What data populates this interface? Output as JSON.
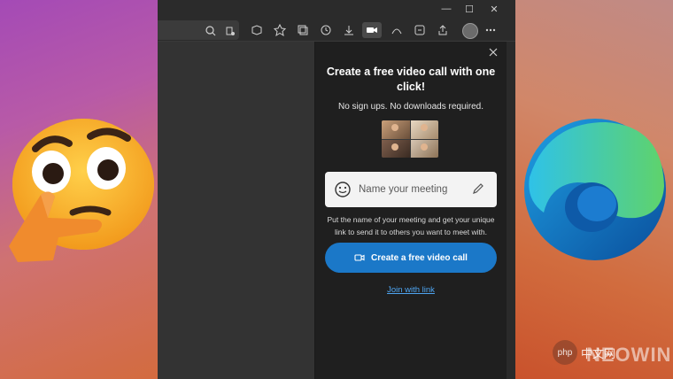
{
  "panel": {
    "title": "Create a free video call with one click!",
    "subtitle": "No sign ups. No downloads required.",
    "meeting_name_placeholder": "Name your meeting",
    "help_text": "Put the name of your meeting and get your unique link to send it to others you want to meet with.",
    "create_button": "Create a free video call",
    "join_link": "Join with link"
  },
  "window_controls": {
    "minimize": "—",
    "maximize": "☐",
    "close": "✕"
  },
  "watermarks": {
    "php": "php",
    "php_cn": "中文网",
    "neowin": "NEOWIN"
  },
  "colors": {
    "accent": "#1b78c8",
    "link": "#4ea4f0",
    "panel_bg": "#1f1f1f",
    "page_bg": "#333333"
  },
  "toolbar_icons": [
    "zoom-icon",
    "read-aloud-icon",
    "extensions-icon",
    "favorites-icon",
    "collections-icon",
    "history-icon",
    "downloads-icon",
    "video-call-icon",
    "performance-icon",
    "math-solver-icon",
    "share-icon",
    "profile-avatar",
    "more-icon"
  ]
}
